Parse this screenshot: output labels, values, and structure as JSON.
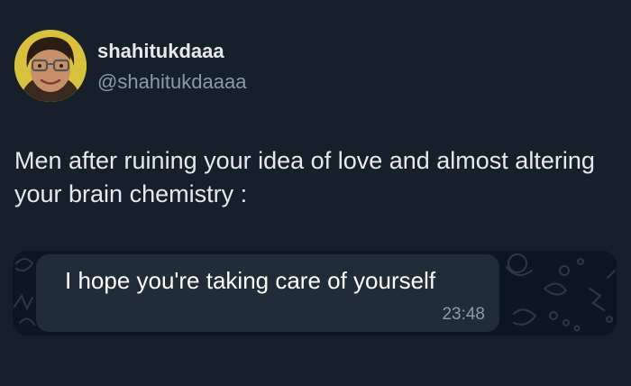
{
  "tweet": {
    "display_name": "shahitukdaaa",
    "handle": "@shahitukdaaaa",
    "text": "Men after ruining your idea of love and almost altering your brain chemistry :"
  },
  "media": {
    "message_text": "I hope you're taking care of yourself",
    "message_time": "23:48"
  },
  "colors": {
    "background": "#15202b",
    "text_primary": "#e7e9ea",
    "text_secondary": "#8b98a5",
    "chat_background": "#0e1621",
    "bubble": "#202c37"
  }
}
